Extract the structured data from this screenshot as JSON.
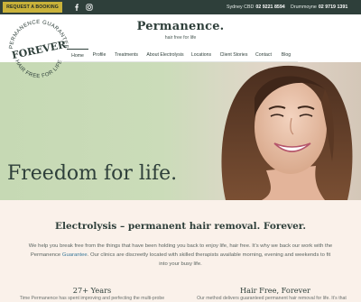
{
  "topbar": {
    "booking_label": "REQUEST A BOOKING",
    "social": [
      "facebook-icon",
      "instagram-icon"
    ],
    "locations": [
      {
        "name": "Sydney CBD",
        "phone": "02 9221 8594"
      },
      {
        "name": "Drummoyne",
        "phone": "02 9719 1391"
      }
    ]
  },
  "header": {
    "logo": "Permanence.",
    "tagline": "hair free for life"
  },
  "nav": {
    "items": [
      "Home",
      "Profile",
      "Treatments",
      "About Electrolysis",
      "Locations",
      "Client Stories",
      "Contact",
      "Blog"
    ],
    "active": "Home"
  },
  "hero": {
    "badge_top": "PERMANENCE GUARANTEE",
    "badge_center": "FOREVER",
    "badge_bottom": "HAIR FREE FOR LIFE",
    "headline": "Freedom for life."
  },
  "intro": {
    "heading": "Electrolysis – permanent hair removal. Forever.",
    "body_before": "We help you break free from the things that have been holding you back to enjoy life, hair free. It’s why we back our work with the Permanence ",
    "body_link": "Guarantee",
    "body_after": ". Our clinics are discreetly located with skilled therapists available morning, evening and weekends to fit into your busy life."
  },
  "columns": [
    {
      "title": "27+ Years",
      "text": "Time Permanence has spent improving and perfecting the multi-probe"
    },
    {
      "title": "Hair Free, Forever",
      "text": "Our method delivers guaranteed permanent hair removal for life. It’s that"
    }
  ],
  "colors": {
    "dark": "#2e3f3a",
    "gold": "#c9b23a",
    "hero_green": "#c8dcb8",
    "intro_bg": "#faf1ea",
    "link": "#3c7a9a"
  }
}
